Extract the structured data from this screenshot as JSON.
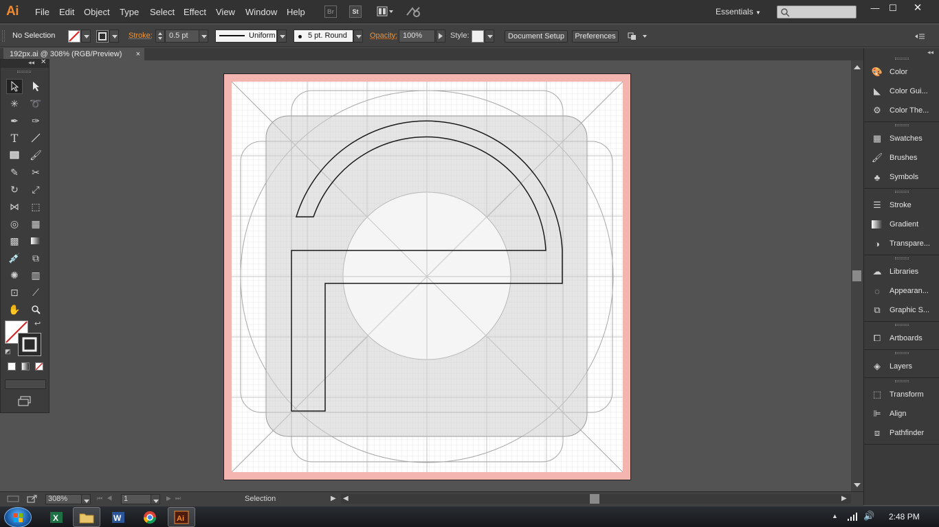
{
  "app": {
    "logo_text": "Ai",
    "menu": [
      "File",
      "Edit",
      "Object",
      "Type",
      "Select",
      "Effect",
      "View",
      "Window",
      "Help"
    ],
    "bridge_label": "Br",
    "stock_label": "St",
    "workspace": "Essentials",
    "search_placeholder": ""
  },
  "control_bar": {
    "selection_state": "No Selection",
    "stroke_label": "Stroke:",
    "stroke_weight": "0.5 pt",
    "stroke_profile": "Uniform",
    "brush": "5 pt. Round",
    "opacity_label": "Opacity:",
    "opacity_value": "100%",
    "style_label": "Style:",
    "document_setup": "Document Setup",
    "preferences": "Preferences"
  },
  "document": {
    "tab_title": "192px.ai @ 308% (RGB/Preview)",
    "close_glyph": "×"
  },
  "status_bar": {
    "zoom": "308%",
    "page": "1",
    "status": "Selection"
  },
  "panels": [
    {
      "label": "Color",
      "icon": "color-palette-icon"
    },
    {
      "label": "Color Gui...",
      "icon": "color-guide-icon"
    },
    {
      "label": "Color The...",
      "icon": "color-themes-icon"
    },
    {
      "label": "Swatches",
      "icon": "swatches-grid-icon"
    },
    {
      "label": "Brushes",
      "icon": "brushes-icon"
    },
    {
      "label": "Symbols",
      "icon": "symbols-club-icon"
    },
    {
      "label": "Stroke",
      "icon": "stroke-lines-icon"
    },
    {
      "label": "Gradient",
      "icon": "gradient-icon"
    },
    {
      "label": "Transpare...",
      "icon": "transparency-icon"
    },
    {
      "label": "Libraries",
      "icon": "libraries-cloud-icon"
    },
    {
      "label": "Appearan...",
      "icon": "appearance-icon"
    },
    {
      "label": "Graphic S...",
      "icon": "graphic-styles-icon"
    },
    {
      "label": "Artboards",
      "icon": "artboards-icon"
    },
    {
      "label": "Layers",
      "icon": "layers-icon"
    },
    {
      "label": "Transform",
      "icon": "transform-icon"
    },
    {
      "label": "Align",
      "icon": "align-icon"
    },
    {
      "label": "Pathfinder",
      "icon": "pathfinder-icon"
    }
  ],
  "taskbar": {
    "clock": "2:48 PM",
    "apps": [
      "excel-icon",
      "explorer-folder-icon",
      "word-icon",
      "chrome-icon",
      "illustrator-icon"
    ]
  },
  "colors": {
    "accent_orange": "#f29434",
    "artboard_bleed": "#f4b5b1",
    "grid_line": "#dcdcdc",
    "path_stroke": "#1a1a1a"
  }
}
